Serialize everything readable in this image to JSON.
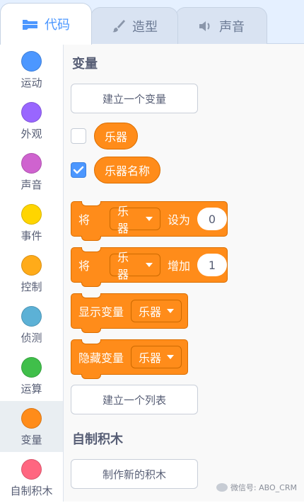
{
  "tabs": [
    {
      "label": "代码",
      "icon": "code-icon",
      "active": true
    },
    {
      "label": "造型",
      "icon": "brush-icon",
      "active": false
    },
    {
      "label": "声音",
      "icon": "speaker-icon",
      "active": false
    }
  ],
  "categories": [
    {
      "label": "运动",
      "color": "#4c97ff"
    },
    {
      "label": "外观",
      "color": "#9966ff"
    },
    {
      "label": "声音",
      "color": "#cf63cf"
    },
    {
      "label": "事件",
      "color": "#ffd500"
    },
    {
      "label": "控制",
      "color": "#ffab19"
    },
    {
      "label": "侦测",
      "color": "#5cb1d6"
    },
    {
      "label": "运算",
      "color": "#40bf4a"
    },
    {
      "label": "变量",
      "color": "#ff8c1a",
      "selected": true
    },
    {
      "label": "自制积木",
      "color": "#ff6680"
    }
  ],
  "palette": {
    "variables_title": "变量",
    "make_variable_button": "建立一个变量",
    "variables": [
      {
        "name": "乐器",
        "checked": false
      },
      {
        "name": "乐器名称",
        "checked": true
      }
    ],
    "set_block": {
      "word1": "将",
      "dropdown": "乐器",
      "word2": "设为",
      "value": "0"
    },
    "change_block": {
      "word1": "将",
      "dropdown": "乐器",
      "word2": "增加",
      "value": "1"
    },
    "show_block": {
      "word1": "显示变量",
      "dropdown": "乐器"
    },
    "hide_block": {
      "word1": "隐藏变量",
      "dropdown": "乐器"
    },
    "make_list_button": "建立一个列表",
    "my_blocks_title": "自制积木",
    "make_block_button": "制作新的积木"
  },
  "watermark": "微信号: ABO_CRM",
  "colors": {
    "accent": "#4c97ff",
    "variables": "#ff8c1a"
  }
}
